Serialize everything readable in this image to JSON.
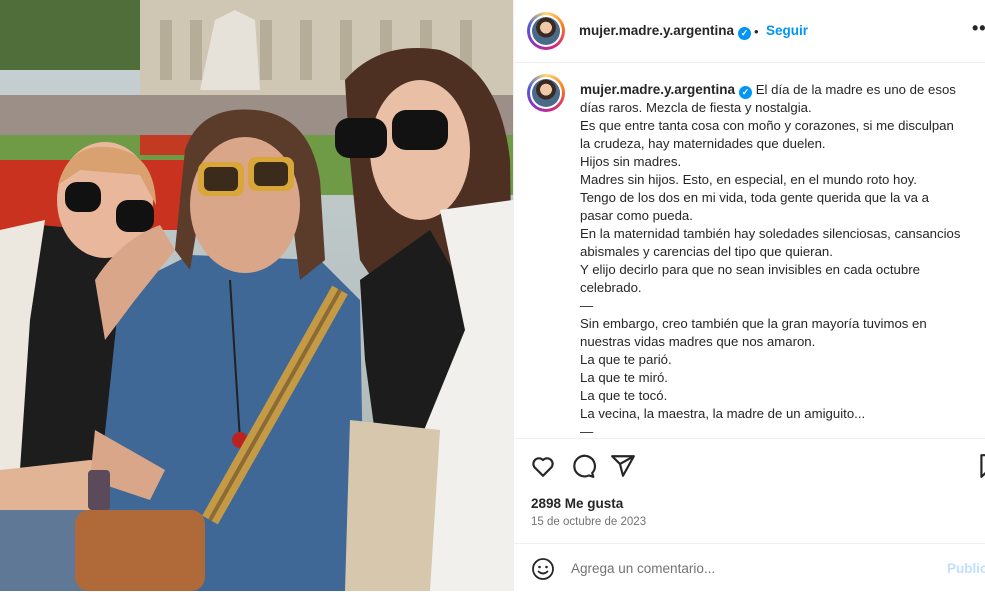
{
  "post": {
    "username": "mujer.madre.y.argentina",
    "verified_mark": "✓",
    "separator": "•",
    "follow_label": "Seguir",
    "more_label": "•••",
    "caption_lines": [
      "El día de la madre es uno de esos",
      "días raros. Mezcla de fiesta y nostalgia.",
      "Es que entre tanta cosa con moño y corazones, si me disculpan",
      "la crudeza, hay maternidades que duelen.",
      "Hijos sin madres.",
      "Madres sin hijos. Esto, en especial, en el mundo roto hoy.",
      "Tengo de los dos en mi vida, toda gente querida que la va a",
      "pasar como pueda.",
      "En la maternidad también hay soledades silenciosas, cansancios",
      "abismales y carencias del tipo que quieran.",
      "Y elijo decirlo para que no sean invisibles en cada octubre",
      "celebrado.",
      "—",
      "Sin embargo, creo también que la gran mayoría tuvimos en",
      "nuestras vidas madres que nos amaron.",
      "La que te parió.",
      "La que te miró.",
      "La que te tocó.",
      "La vecina, la maestra, la madre de un amiguito...",
      "—"
    ],
    "likes": "2898 Me gusta",
    "date": "15 de octubre de 2023",
    "comment_placeholder": "Agrega un comentario...",
    "publish_label": "Publicar"
  },
  "icons": [
    "heart-icon",
    "comment-icon",
    "share-icon",
    "bookmark-icon",
    "emoji-icon",
    "verified-icon",
    "more-icon"
  ],
  "colors": {
    "accent": "#0095f6",
    "text": "#262626",
    "muted": "#737373",
    "border": "#efefef"
  }
}
